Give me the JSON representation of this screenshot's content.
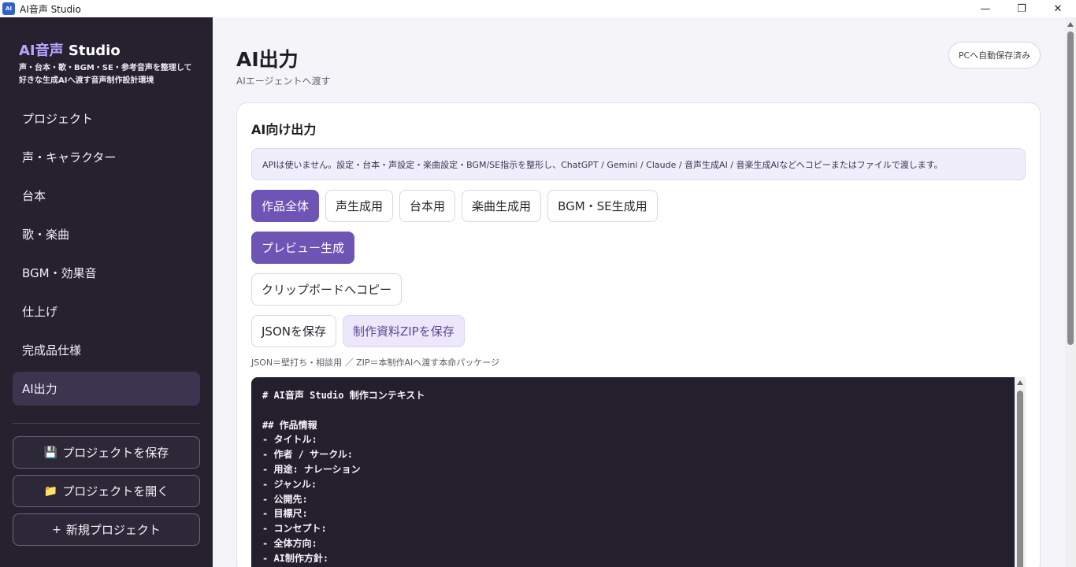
{
  "window": {
    "title": "AI音声 Studio",
    "icon_text": "AI",
    "minimize": "—",
    "maximize": "❐",
    "close": "✕"
  },
  "sidebar": {
    "brand_accent": "AI音声",
    "brand_rest": " Studio",
    "tagline_line1": "声・台本・歌・BGM・SE・参考音声を整理して",
    "tagline_line2": "好きな生成AIへ渡す音声制作設計環境",
    "nav": [
      {
        "label": "プロジェクト",
        "active": false
      },
      {
        "label": "声・キャラクター",
        "active": false
      },
      {
        "label": "台本",
        "active": false
      },
      {
        "label": "歌・楽曲",
        "active": false
      },
      {
        "label": "BGM・効果音",
        "active": false
      },
      {
        "label": "仕上げ",
        "active": false
      },
      {
        "label": "完成品仕様",
        "active": false
      },
      {
        "label": "AI出力",
        "active": true
      }
    ],
    "save_project": {
      "icon": "💾",
      "label": "プロジェクトを保存"
    },
    "open_project": {
      "icon": "📁",
      "label": "プロジェクトを開く"
    },
    "new_project": {
      "icon": "+",
      "label": "新規プロジェクト"
    }
  },
  "header": {
    "title": "AI出力",
    "subtitle": "AIエージェントへ渡す",
    "autosave": "PCへ自動保存済み"
  },
  "card": {
    "title": "AI向け出力",
    "info": "APIは使いません。設定・台本・声設定・楽曲設定・BGM/SE指示を整形し、ChatGPT / Gemini / Claude / 音声生成AI / 音楽生成AIなどへコピーまたはファイルで渡します。",
    "tabs": [
      "作品全体",
      "声生成用",
      "台本用",
      "楽曲生成用",
      "BGM・SE生成用"
    ],
    "preview_button": "プレビュー生成",
    "copy_button": "クリップボードへコピー",
    "json_button": "JSONを保存",
    "zip_button": "制作資料ZIPを保存",
    "hint": "JSON＝壁打ち・相談用 ／ ZIP＝本制作AIへ渡す本命パッケージ",
    "code_lines": [
      "# AI音声 Studio 制作コンテキスト",
      "",
      "## 作品情報",
      "- タイトル:",
      "- 作者 / サークル:",
      "- 用途: ナレーション",
      "- ジャンル:",
      "- 公開先:",
      "- 目標尺:",
      "- コンセプト:",
      "- 全体方向:",
      "- AI制作方針:"
    ]
  }
}
